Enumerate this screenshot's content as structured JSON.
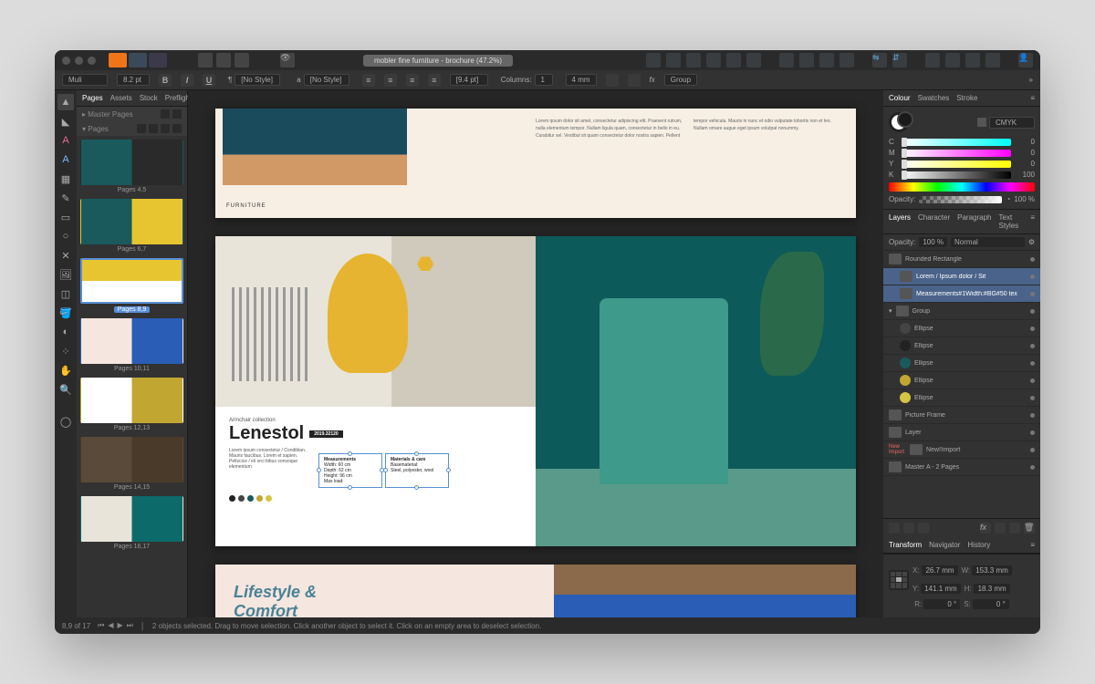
{
  "title": "mobler fine furniture - brochure (47.2%)",
  "contextBar": {
    "font": "Muli",
    "size": "8.2 pt",
    "paraStyle": "[No Style]",
    "charStyle": "[No Style]",
    "leading": "[9.4 pt]",
    "columnsLabel": "Columns:",
    "columns": "1",
    "gutter": "4 mm",
    "groupLabel": "Group"
  },
  "pagesPanel": {
    "tabs": [
      "Pages",
      "Assets",
      "Stock",
      "Preflight"
    ],
    "masterHeader": "Master Pages",
    "pagesHeader": "Pages",
    "thumbs": [
      {
        "label": "Pages 4,5"
      },
      {
        "label": "Pages 6,7"
      },
      {
        "label": "Pages 8,9",
        "selected": true
      },
      {
        "label": "Pages 10,11"
      },
      {
        "label": "Pages 12,13"
      },
      {
        "label": "Pages 14,15"
      },
      {
        "label": "Pages 16,17"
      }
    ]
  },
  "canvas": {
    "spread1": {
      "label": "FURNITURE",
      "body": "Lorem ipsum dolor sit amet, consectetur adipiscing elit. Praesent rutrum, nulla elementum tempor. Nullam ligula quam, consectetur in bello in eu. Curabitur sel. Vestibul sit quam consectetur dolor nostra sapien. Pellent tempor vehicula. Mauris in nunc et odio vulputate lobortis non et leo. Nullam ornare augue eget ipsum volutpat nonummy."
    },
    "spread2": {
      "subtitle": "Armchair collection",
      "title": "Lenestol",
      "badge": "2019.32120",
      "desc": "Lorem ipsum consectetur / Condiblan. Mauris faucibus. Lorem et sapien. Peltzcice / eli orci bibus vonsoque elementum",
      "box1": {
        "h": "Measurements",
        "l1": "Width: 60 cm",
        "l2": "Depth: 62 cm",
        "l3": "Height: 96 cm",
        "l4": "Max load:"
      },
      "box2": {
        "h": "Materials & care",
        "l1": "Basematerial:",
        "l2": "Steel, polyester, wool"
      },
      "swatches": [
        "#222",
        "#444",
        "#1a5a5c",
        "#c2a632",
        "#d4c545"
      ]
    },
    "spread3": {
      "line1": "Lifestyle &",
      "line2": "Comfort"
    }
  },
  "colourPanel": {
    "tabs": [
      "Colour",
      "Swatches",
      "Stroke"
    ],
    "mode": "CMYK",
    "sliders": [
      {
        "label": "C",
        "val": "0",
        "bg": "linear-gradient(90deg,#fff,#0ff)"
      },
      {
        "label": "M",
        "val": "0",
        "bg": "linear-gradient(90deg,#fff,#f0f)"
      },
      {
        "label": "Y",
        "val": "0",
        "bg": "linear-gradient(90deg,#fff,#ff0)"
      },
      {
        "label": "K",
        "val": "100",
        "bg": "linear-gradient(90deg,#fff,#000)"
      }
    ],
    "opacityLabel": "Opacity:",
    "opacity": "100 %"
  },
  "layersPanel": {
    "tabs": [
      "Layers",
      "Character",
      "Paragraph",
      "Text Styles"
    ],
    "opacityLabel": "Opacity:",
    "opacity": "100 %",
    "blend": "Normal",
    "items": [
      {
        "name": "Rounded Rectangle",
        "indent": 0
      },
      {
        "name": "Lorem / Ipsum dolor / Sit",
        "indent": 1,
        "sel": true
      },
      {
        "name": "Measurements#1Width:#BG#50 tex",
        "indent": 1,
        "sel": true
      },
      {
        "name": "Group",
        "indent": 0,
        "expanded": true
      },
      {
        "name": "Ellipse",
        "indent": 1,
        "swatch": "#444"
      },
      {
        "name": "Ellipse",
        "indent": 1,
        "swatch": "#222"
      },
      {
        "name": "Ellipse",
        "indent": 1,
        "swatch": "#1a5a5c"
      },
      {
        "name": "Ellipse",
        "indent": 1,
        "swatch": "#c2a632"
      },
      {
        "name": "Ellipse",
        "indent": 1,
        "swatch": "#d4c545"
      },
      {
        "name": "Picture Frame",
        "indent": 0
      },
      {
        "name": "Layer",
        "indent": 0
      },
      {
        "name": "New!!import",
        "indent": 0,
        "badge": true
      },
      {
        "name": "Master A - 2 Pages",
        "indent": 0
      }
    ]
  },
  "transformPanel": {
    "tabs": [
      "Transform",
      "Navigator",
      "History"
    ],
    "x": "26.7 mm",
    "y": "141.1 mm",
    "w": "153.3 mm",
    "h": "18.3 mm",
    "r": "0 °",
    "s": "0 °",
    "xl": "X:",
    "yl": "Y:",
    "wl": "W:",
    "hl": "H:",
    "rl": "R:",
    "sl": "S:"
  },
  "status": {
    "pages": "8,9 of 17",
    "hint": "2 objects selected. Drag to move selection. Click another object to select it. Click on an empty area to deselect selection."
  }
}
